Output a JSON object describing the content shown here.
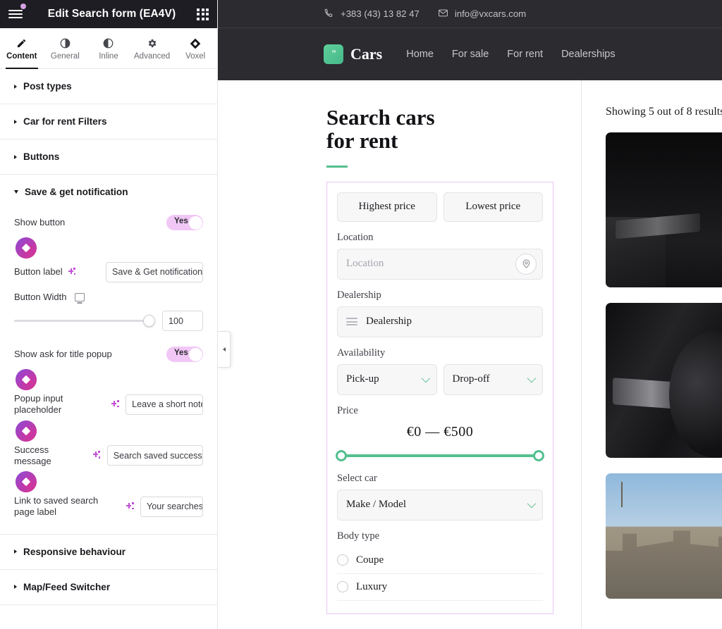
{
  "editor": {
    "title": "Edit Search form (EA4V)",
    "menu_icon": "hamburger-icon",
    "grid_icon": "grid-apps-icon",
    "tabs": [
      {
        "label": "Content",
        "icon": "pencil-icon",
        "active": true
      },
      {
        "label": "General",
        "icon": "contrast-icon",
        "active": false
      },
      {
        "label": "Inline",
        "icon": "contrast-icon",
        "active": false
      },
      {
        "label": "Advanced",
        "icon": "gear-icon",
        "active": false
      },
      {
        "label": "Voxel",
        "icon": "diamond-icon",
        "active": false
      }
    ],
    "sections": [
      {
        "label": "Post types",
        "open": false
      },
      {
        "label": "Car for rent Filters",
        "open": false
      },
      {
        "label": "Buttons",
        "open": false
      },
      {
        "label": "Save & get notification",
        "open": true
      },
      {
        "label": "Responsive behaviour",
        "open": false
      },
      {
        "label": "Map/Feed Switcher",
        "open": false
      }
    ],
    "save_section": {
      "show_button": {
        "label": "Show button",
        "toggle_value": "Yes",
        "state": "on"
      },
      "button_label": {
        "label": "Button label",
        "value": "Save & Get notification",
        "ai_icon": "sparkle-icon"
      },
      "button_width": {
        "label": "Button Width",
        "device_icon": "desktop-icon",
        "value": "100",
        "slider_percent": 100
      },
      "show_ask_popup": {
        "label": "Show ask for title popup",
        "toggle_value": "Yes",
        "state": "on"
      },
      "popup_placeholder": {
        "label": "Popup input placeholder",
        "value": "Leave a short note.",
        "ai_icon": "sparkle-icon"
      },
      "success_message": {
        "label": "Success message",
        "value": "Search saved successf",
        "ai_icon": "sparkle-icon"
      },
      "saved_search_link": {
        "label": "Link to saved search page label",
        "value": "Your searches",
        "ai_icon": "sparkle-icon"
      }
    },
    "collapse_handle_icon": "chevron-left-icon"
  },
  "site": {
    "topbar": {
      "phone": "+383 (43) 13 82 47",
      "phone_icon": "phone-icon",
      "email": "info@vxcars.com",
      "email_icon": "envelope-icon"
    },
    "brand": {
      "name": "Cars",
      "logo_glyph": "\""
    },
    "nav": [
      {
        "label": "Home"
      },
      {
        "label": "For sale"
      },
      {
        "label": "For rent"
      },
      {
        "label": "Dealerships"
      }
    ]
  },
  "search_form": {
    "heading_line1": "Search cars",
    "heading_line2": "for rent",
    "sort_buttons": [
      {
        "label": "Highest price"
      },
      {
        "label": "Lowest price"
      }
    ],
    "location": {
      "label": "Location",
      "placeholder": "Location",
      "pin_icon": "map-pin-icon"
    },
    "dealership": {
      "label": "Dealership",
      "value": "Dealership",
      "icon": "list-icon"
    },
    "availability": {
      "label": "Availability",
      "pickup": {
        "value": "Pick-up",
        "icon": "chevron-down-icon"
      },
      "dropoff": {
        "value": "Drop-off",
        "icon": "chevron-down-icon"
      }
    },
    "price": {
      "label": "Price",
      "display": "€0 — €500",
      "min": "€0",
      "max": "€500",
      "track_color": "#54c08f"
    },
    "select_car": {
      "label": "Select car",
      "value": "Make / Model",
      "icon": "chevron-down-icon"
    },
    "body_type": {
      "label": "Body type",
      "options": [
        {
          "label": "Coupe",
          "checked": false
        },
        {
          "label": "Luxury",
          "checked": false
        }
      ]
    }
  },
  "results": {
    "count_text": "Showing 5 out of 8 results",
    "cards": [
      {
        "image_alt": "car-interior-dark-dashboard"
      },
      {
        "image_alt": "car-interior-door-steering-wheel"
      },
      {
        "image_alt": "historic-castle-building-blue-sky"
      }
    ]
  }
}
